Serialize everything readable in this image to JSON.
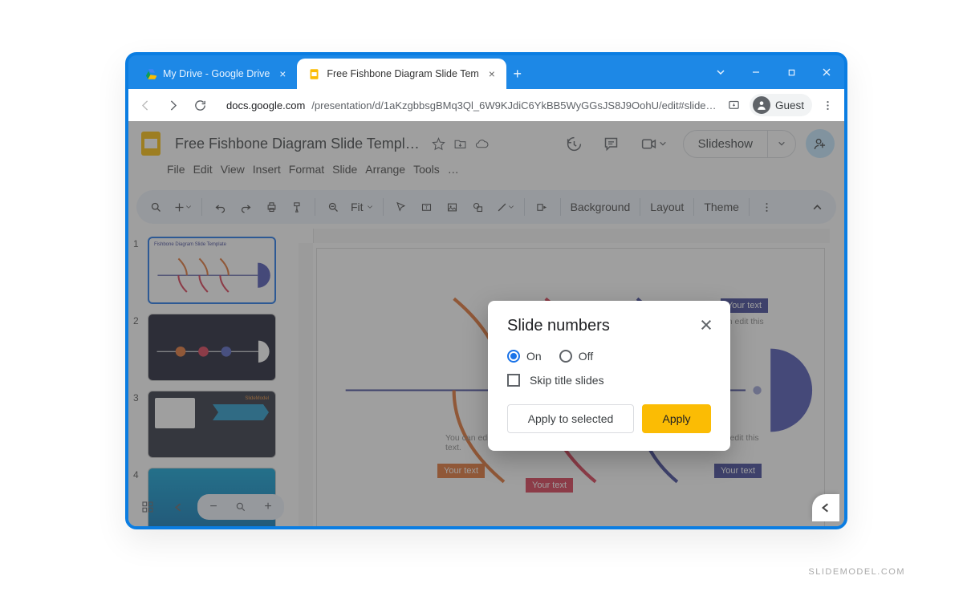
{
  "browser": {
    "tabs": [
      {
        "title": "My Drive - Google Drive",
        "active": false
      },
      {
        "title": "Free Fishbone Diagram Slide Tem",
        "active": true
      }
    ],
    "url_host": "docs.google.com",
    "url_path": "/presentation/d/1aKzgbbsgBMq3Ql_6W9KJdiC6YkBB5WyGGsJS8J9OohU/edit#slide…",
    "guest_label": "Guest"
  },
  "app": {
    "title": "Free Fishbone Diagram Slide Template…",
    "menus": [
      "File",
      "Edit",
      "View",
      "Insert",
      "Format",
      "Slide",
      "Arrange",
      "Tools",
      "…"
    ],
    "slideshow_label": "Slideshow",
    "zoom_label": "Fit",
    "toolbar_text": {
      "background": "Background",
      "layout": "Layout",
      "theme": "Theme"
    }
  },
  "thumbnails": [
    1,
    2,
    3,
    4
  ],
  "slide": {
    "labels": {
      "your_text": "Your text"
    },
    "edit_text": "You can edit this text."
  },
  "dialog": {
    "title": "Slide numbers",
    "on_label": "On",
    "off_label": "Off",
    "skip_label": "Skip title slides",
    "apply_selected": "Apply to selected",
    "apply": "Apply",
    "selected": "on",
    "skip_checked": false
  },
  "watermark": "SLIDEMODEL.COM"
}
